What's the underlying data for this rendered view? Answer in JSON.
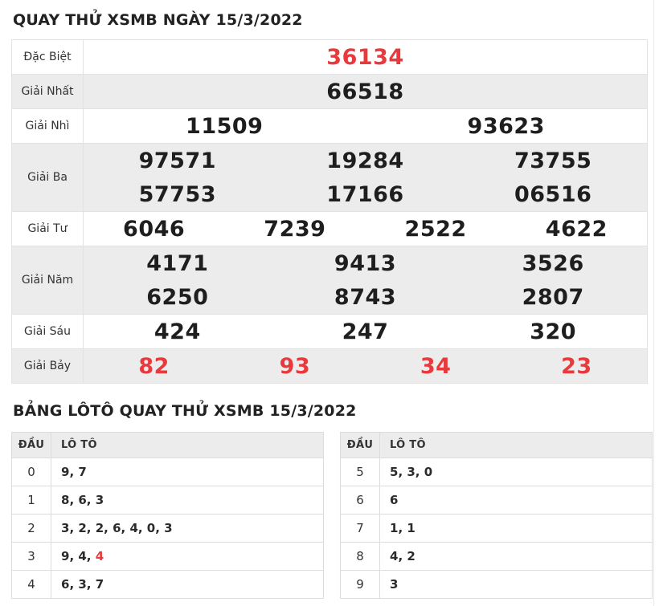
{
  "page": {
    "title": "QUAY THỬ XSMB NGÀY 15/3/2022",
    "loto_title": "BẢNG LÔTÔ QUAY THỬ XSMB 15/3/2022"
  },
  "colors": {
    "accent_red": "#e8393d",
    "number_black": "#1e1e1e",
    "row_alt_bg": "#ececec",
    "border": "#e2e2e2"
  },
  "prize_table": {
    "rows": [
      {
        "label": "Đặc Biệt",
        "red": true,
        "lines": [
          [
            "36134"
          ]
        ]
      },
      {
        "label": "Giải Nhất",
        "red": false,
        "lines": [
          [
            "66518"
          ]
        ]
      },
      {
        "label": "Giải Nhì",
        "red": false,
        "lines": [
          [
            "11509",
            "93623"
          ]
        ]
      },
      {
        "label": "Giải Ba",
        "red": false,
        "lines": [
          [
            "97571",
            "19284",
            "73755"
          ],
          [
            "57753",
            "17166",
            "06516"
          ]
        ]
      },
      {
        "label": "Giải Tư",
        "red": false,
        "lines": [
          [
            "6046",
            "7239",
            "2522",
            "4622"
          ]
        ]
      },
      {
        "label": "Giải Năm",
        "red": false,
        "lines": [
          [
            "4171",
            "9413",
            "3526"
          ],
          [
            "6250",
            "8743",
            "2807"
          ]
        ]
      },
      {
        "label": "Giải Sáu",
        "red": false,
        "lines": [
          [
            "424",
            "247",
            "320"
          ]
        ]
      },
      {
        "label": "Giải Bảy",
        "red": true,
        "lines": [
          [
            "82",
            "93",
            "34",
            "23"
          ]
        ]
      }
    ]
  },
  "loto_tables": [
    {
      "headers": [
        "ĐẦU",
        "LÔ TÔ"
      ],
      "rows": [
        {
          "dau": "0",
          "loto": [
            {
              "text": "9"
            },
            {
              "text": "7"
            }
          ]
        },
        {
          "dau": "1",
          "loto": [
            {
              "text": "8"
            },
            {
              "text": "6"
            },
            {
              "text": "3"
            }
          ]
        },
        {
          "dau": "2",
          "loto": [
            {
              "text": "3"
            },
            {
              "text": "2"
            },
            {
              "text": "2"
            },
            {
              "text": "6"
            },
            {
              "text": "4"
            },
            {
              "text": "0"
            },
            {
              "text": "3"
            }
          ]
        },
        {
          "dau": "3",
          "loto": [
            {
              "text": "9"
            },
            {
              "text": "4"
            },
            {
              "text": "4",
              "red": true
            }
          ]
        },
        {
          "dau": "4",
          "loto": [
            {
              "text": "6"
            },
            {
              "text": "3"
            },
            {
              "text": "7"
            }
          ]
        }
      ]
    },
    {
      "headers": [
        "ĐẦU",
        "LÔ TÔ"
      ],
      "rows": [
        {
          "dau": "5",
          "loto": [
            {
              "text": "5"
            },
            {
              "text": "3"
            },
            {
              "text": "0"
            }
          ]
        },
        {
          "dau": "6",
          "loto": [
            {
              "text": "6"
            }
          ]
        },
        {
          "dau": "7",
          "loto": [
            {
              "text": "1"
            },
            {
              "text": "1"
            }
          ]
        },
        {
          "dau": "8",
          "loto": [
            {
              "text": "4"
            },
            {
              "text": "2"
            }
          ]
        },
        {
          "dau": "9",
          "loto": [
            {
              "text": "3"
            }
          ]
        }
      ]
    }
  ]
}
